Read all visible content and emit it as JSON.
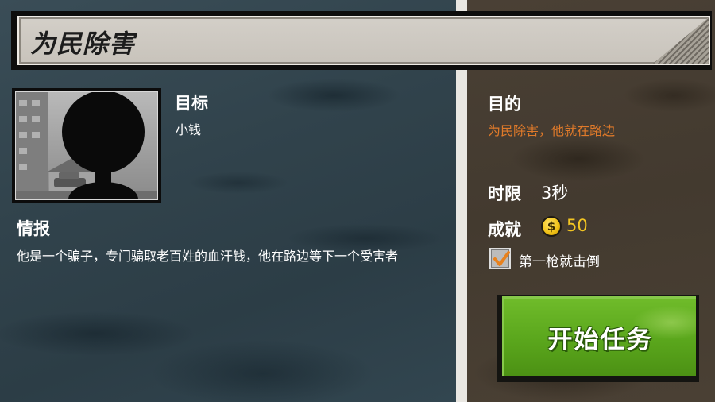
{
  "mission": {
    "title": "为民除害"
  },
  "target": {
    "label": "目标",
    "name": "小钱"
  },
  "intel": {
    "label": "情报",
    "text": "他是一个骗子，专门骗取老百姓的血汗钱，他在路边等下一个受害者"
  },
  "objective": {
    "label": "目的",
    "text": "为民除害，他就在路边"
  },
  "time_limit": {
    "label": "时限",
    "value": "3秒"
  },
  "achievement": {
    "label": "成就",
    "coin_symbol": "$",
    "reward": "50",
    "task_text": "第一枪就击倒",
    "task_checked": true
  },
  "start_button": {
    "label": "开始任务"
  },
  "colors": {
    "left_panel": "#31434c",
    "right_panel": "#433a2f",
    "objective_text": "#e07a2a",
    "reward_text": "#f3c522",
    "start_button": "#5aa61c",
    "checkmark": "#e8821e"
  }
}
